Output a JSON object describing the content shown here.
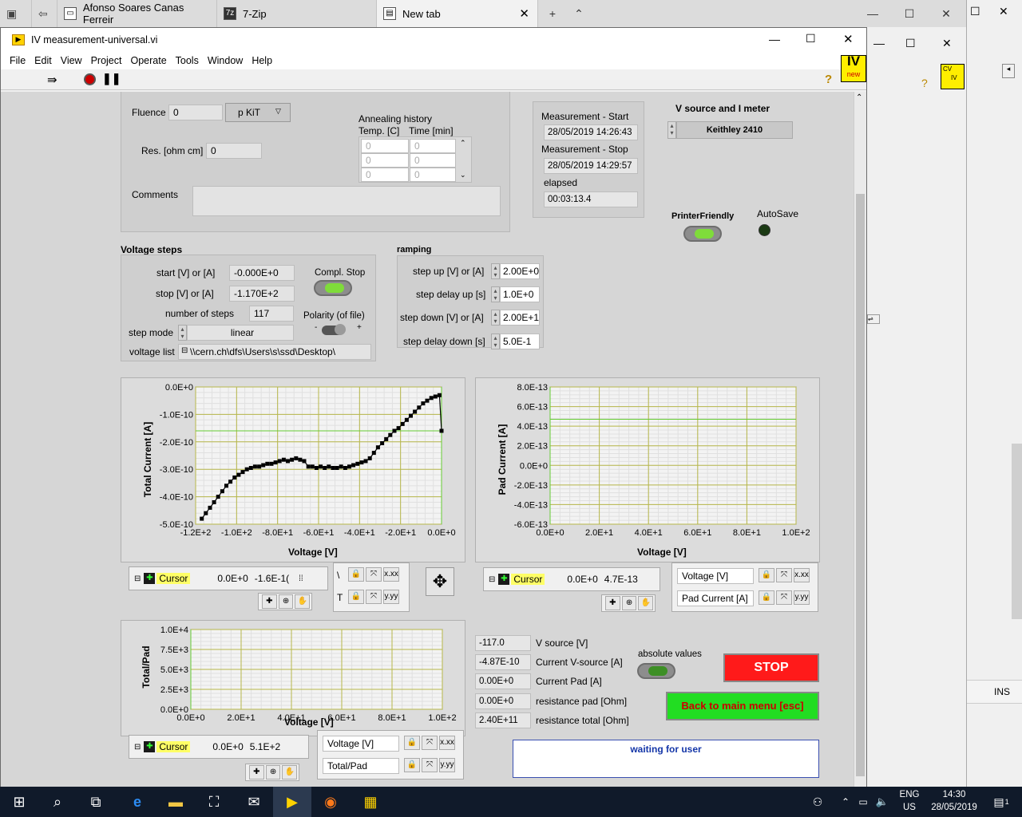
{
  "browser": {
    "tabs": [
      {
        "label": "Afonso Soares Canas Ferreir"
      },
      {
        "label": "7-Zip"
      },
      {
        "label": "New tab"
      }
    ]
  },
  "window": {
    "title": "IV measurement-universal.vi"
  },
  "menu": [
    "File",
    "Edit",
    "View",
    "Project",
    "Operate",
    "Tools",
    "Window",
    "Help"
  ],
  "sample": {
    "fluence_label": "Fluence",
    "fluence_value": "0",
    "fluence_unit": "p KiT",
    "res_label": "Res. [ohm cm]",
    "res_value": "0",
    "comments_label": "Comments",
    "annealing_title": "Annealing history",
    "annealing_col1": "Temp. [C]",
    "annealing_col2": "Time [min]",
    "annealing_rows": [
      [
        "0",
        "0"
      ],
      [
        "0",
        "0"
      ],
      [
        "0",
        "0"
      ]
    ]
  },
  "measurement": {
    "start_label": "Measurement - Start",
    "start_value": "28/05/2019 14:26:43",
    "stop_label": "Measurement - Stop",
    "stop_value": "28/05/2019 14:29:57",
    "elapsed_label": "elapsed",
    "elapsed_value": "00:03:13.4"
  },
  "source": {
    "title": "V source and I meter",
    "value": "Keithley 2410"
  },
  "printer_label": "PrinterFriendly",
  "autosave_label": "AutoSave",
  "voltage_steps": {
    "title": "Voltage steps",
    "start_label": "start [V] or [A]",
    "start_value": "-0.000E+0",
    "stop_label": "stop [V] or [A]",
    "stop_value": "-1.170E+2",
    "num_label": "number of steps",
    "num_value": "117",
    "mode_label": "step mode",
    "mode_value": "linear",
    "list_label": "voltage list",
    "list_value": "\\\\cern.ch\\dfs\\Users\\s\\ssd\\Desktop\\",
    "compl_label": "Compl. Stop",
    "polarity_label": "Polarity (of file)",
    "pol_minus": "-",
    "pol_plus": "+"
  },
  "ramping": {
    "title": "ramping",
    "up_label": "step up [V] or [A]",
    "up_value": "2.00E+0",
    "delay_up_label": "step delay up [s]",
    "delay_up_value": "1.0E+0",
    "down_label": "step down [V] or [A]",
    "down_value": "2.00E+1",
    "delay_down_label": "step delay down [s]",
    "delay_down_value": "5.0E-1"
  },
  "chart_data": [
    {
      "type": "scatter",
      "ylabel": "Total Current [A]",
      "xlabel": "Voltage [V]",
      "xlim": [
        -120,
        0
      ],
      "ylim": [
        -5e-10,
        0.0
      ],
      "xticks": [
        "-1.2E+2",
        "-1.0E+2",
        "-8.0E+1",
        "-6.0E+1",
        "-4.0E+1",
        "-2.0E+1",
        "0.0E+0"
      ],
      "yticks": [
        "0.0E+0",
        "-1.0E-10",
        "-2.0E-10",
        "-3.0E-10",
        "-4.0E-10",
        "-5.0E-10"
      ],
      "x": [
        -117,
        -115,
        -113,
        -111,
        -109,
        -107,
        -105,
        -103,
        -101,
        -99,
        -97,
        -95,
        -93,
        -91,
        -89,
        -87,
        -85,
        -83,
        -81,
        -79,
        -77,
        -75,
        -73,
        -71,
        -69,
        -67,
        -65,
        -63,
        -61,
        -59,
        -57,
        -55,
        -53,
        -51,
        -49,
        -47,
        -45,
        -43,
        -41,
        -39,
        -37,
        -35,
        -33,
        -31,
        -29,
        -27,
        -25,
        -23,
        -21,
        -19,
        -17,
        -15,
        -13,
        -11,
        -9,
        -7,
        -5,
        -3,
        -1,
        0
      ],
      "y": [
        -4.8e-10,
        -4.6e-10,
        -4.4e-10,
        -4.2e-10,
        -4e-10,
        -3.8e-10,
        -3.6e-10,
        -3.45e-10,
        -3.3e-10,
        -3.2e-10,
        -3.1e-10,
        -3e-10,
        -2.95e-10,
        -2.9e-10,
        -2.9e-10,
        -2.85e-10,
        -2.8e-10,
        -2.8e-10,
        -2.75e-10,
        -2.7e-10,
        -2.65e-10,
        -2.7e-10,
        -2.65e-10,
        -2.6e-10,
        -2.65e-10,
        -2.7e-10,
        -2.9e-10,
        -2.9e-10,
        -2.95e-10,
        -2.9e-10,
        -2.95e-10,
        -2.9e-10,
        -2.95e-10,
        -2.95e-10,
        -2.9e-10,
        -2.95e-10,
        -2.9e-10,
        -2.85e-10,
        -2.8e-10,
        -2.75e-10,
        -2.7e-10,
        -2.6e-10,
        -2.4e-10,
        -2.2e-10,
        -2.05e-10,
        -1.9e-10,
        -1.75e-10,
        -1.6e-10,
        -1.5e-10,
        -1.35e-10,
        -1.2e-10,
        -1.05e-10,
        -9e-11,
        -7.5e-11,
        -6e-11,
        -5e-11,
        -4e-11,
        -3.5e-11,
        -3e-11,
        -1.6e-10
      ]
    },
    {
      "type": "line",
      "ylabel": "Pad Current [A]",
      "xlabel": "Voltage [V]",
      "xlim": [
        0,
        100
      ],
      "ylim": [
        -6e-13,
        8e-13
      ],
      "xticks": [
        "0.0E+0",
        "2.0E+1",
        "4.0E+1",
        "6.0E+1",
        "8.0E+1",
        "1.0E+2"
      ],
      "yticks": [
        "8.0E-13",
        "6.0E-13",
        "4.0E-13",
        "2.0E-13",
        "0.0E+0",
        "-2.0E-13",
        "-4.0E-13",
        "-6.0E-13"
      ]
    },
    {
      "type": "line",
      "ylabel": "Total/Pad",
      "xlabel": "Voltage [V]",
      "xlim": [
        0,
        100
      ],
      "ylim": [
        0,
        10000
      ],
      "xticks": [
        "0.0E+0",
        "2.0E+1",
        "4.0E+1",
        "6.0E+1",
        "8.0E+1",
        "1.0E+2"
      ],
      "yticks": [
        "1.0E+4",
        "7.5E+3",
        "5.0E+3",
        "2.5E+3",
        "0.0E+0"
      ]
    }
  ],
  "cursor1": {
    "name": "Cursor",
    "x": "0.0E+0",
    "y": "-1.6E-1("
  },
  "cursor2": {
    "name": "Cursor",
    "x": "0.0E+0",
    "y": "4.7E-13"
  },
  "cursor3": {
    "name": "Cursor",
    "x": "0.0E+0",
    "y": "5.1E+2"
  },
  "scale2": {
    "x": "Voltage [V]",
    "y": "Pad Current [A]"
  },
  "scale3": {
    "x": "Voltage [V]",
    "y": "Total/Pad"
  },
  "readouts": [
    {
      "value": "-117.0",
      "label": "V source [V]"
    },
    {
      "value": "-4.87E-10",
      "label": "Current V-source [A]"
    },
    {
      "value": "0.00E+0",
      "label": "Current Pad  [A]"
    },
    {
      "value": "0.00E+0",
      "label": "resistance pad  [Ohm]"
    },
    {
      "value": "2.40E+11",
      "label": "resistance total  [Ohm]"
    }
  ],
  "absolute_label": "absolute values",
  "stop_label": "STOP",
  "back_label": "Back to main menu [esc]",
  "status": "waiting for user",
  "right_windows": {
    "badge1": "IV",
    "badge1b": "new",
    "badge2": "CV",
    "badge2b": "IV",
    "ins": "INS"
  },
  "taskbar": {
    "lang1": "ENG",
    "lang2": "US",
    "time": "14:30",
    "date": "28/05/2019",
    "notif": "1"
  },
  "colors": {
    "stop_red": "#ff1a1a",
    "back_green": "#22dd22",
    "led_green": "#7fdc3a",
    "grid_green": "#8bd45a",
    "grid_olive": "#b7b74a"
  }
}
